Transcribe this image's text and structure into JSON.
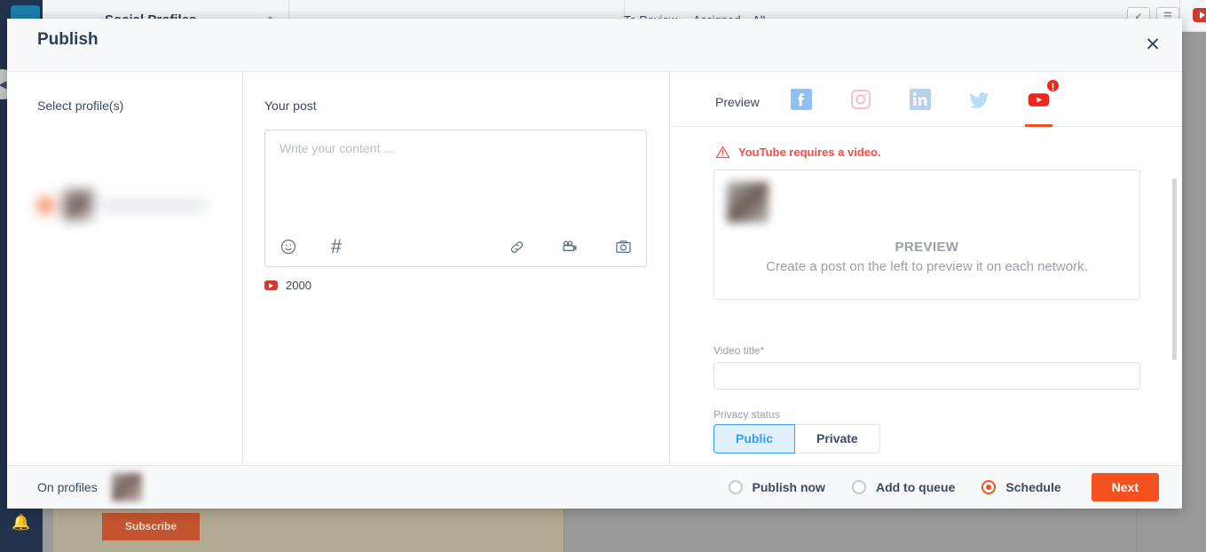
{
  "background": {
    "app_title": "Social Profiles",
    "tabs": [
      "To Review",
      "Assigned",
      "All"
    ],
    "subscribe_label": "Subscribe",
    "icons": {
      "pencil": "pencil-icon",
      "check_square": "check-square-icon",
      "list": "list-icon",
      "youtube": "youtube-icon",
      "gear": "gear-icon",
      "collapse": "collapse-left-icon",
      "bell": "bell-icon"
    }
  },
  "modal": {
    "title": "Publish",
    "close_label": "✕",
    "profiles": {
      "heading": "Select profile(s)"
    },
    "post": {
      "heading": "Your post",
      "placeholder": "Write your content ...",
      "value": "",
      "char_count": "2000",
      "tools": [
        "emoji-icon",
        "hashtag-icon",
        "link-icon",
        "video-camera-icon",
        "camera-icon"
      ],
      "hashtag_glyph": "#"
    },
    "preview": {
      "label": "Preview",
      "networks": [
        {
          "name": "facebook",
          "active": false,
          "error": false
        },
        {
          "name": "instagram",
          "active": false,
          "error": false
        },
        {
          "name": "linkedin",
          "active": false,
          "error": false
        },
        {
          "name": "twitter",
          "active": false,
          "error": false
        },
        {
          "name": "youtube",
          "active": true,
          "error": true,
          "badge": "!"
        }
      ],
      "warning": "YouTube requires a video.",
      "box_title": "PREVIEW",
      "box_subtitle": "Create a post on the left to preview it on each network.",
      "video_title_label": "Video title*",
      "video_title_value": "",
      "video_title_placeholder": "",
      "privacy_label": "Privacy status",
      "privacy_options": [
        {
          "label": "Public",
          "selected": true
        },
        {
          "label": "Private",
          "selected": false
        }
      ]
    },
    "footer": {
      "on_profiles_label": "On profiles",
      "schedule_options": [
        {
          "label": "Publish now",
          "selected": false
        },
        {
          "label": "Add to queue",
          "selected": false
        },
        {
          "label": "Schedule",
          "selected": true
        }
      ],
      "next_label": "Next"
    }
  },
  "colors": {
    "accent_orange": "#f4511e",
    "error_red": "#fa4b42",
    "selected_blue": "#3b9cf7",
    "sidebar_navy": "#23334e",
    "text_slate": "#3c4a60"
  }
}
